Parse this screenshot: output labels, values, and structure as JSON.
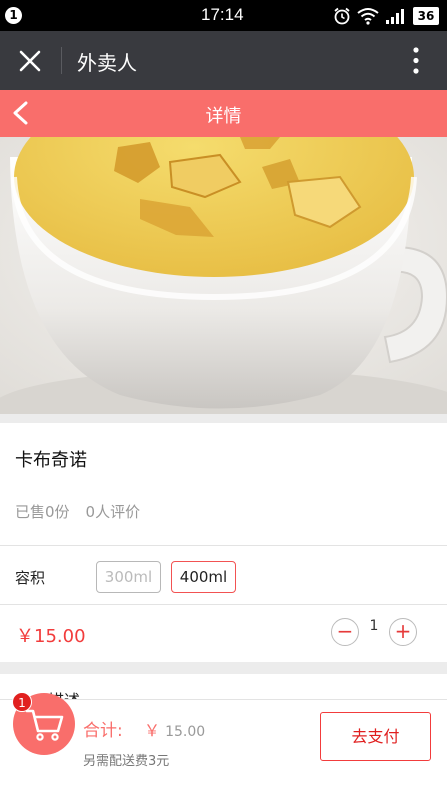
{
  "status_bar": {
    "notification_count": "1",
    "time": "17:14",
    "battery": "36"
  },
  "wechat_bar": {
    "title": "外卖人"
  },
  "page_header": {
    "title": "详情"
  },
  "product": {
    "name": "卡布奇诺",
    "sold": "已售0份",
    "reviews": "0人评价",
    "volume_label": "容积",
    "options": [
      {
        "label": "300ml",
        "state": "disabled"
      },
      {
        "label": "400ml",
        "state": "selected"
      }
    ],
    "price": "￥15.00",
    "quantity": "1",
    "stepper_minus": "−",
    "stepper_plus": "+"
  },
  "description": {
    "heading": "描述"
  },
  "cart": {
    "badge_count": "1",
    "total_label": "合计:",
    "currency": "￥",
    "total_value": "15.00",
    "delivery_fee_text": "另需配送费3元",
    "pay_label": "去支付"
  },
  "colors": {
    "accent": "#f96e6b",
    "price_red": "#f23c3c",
    "topbar": "#393a3f"
  }
}
